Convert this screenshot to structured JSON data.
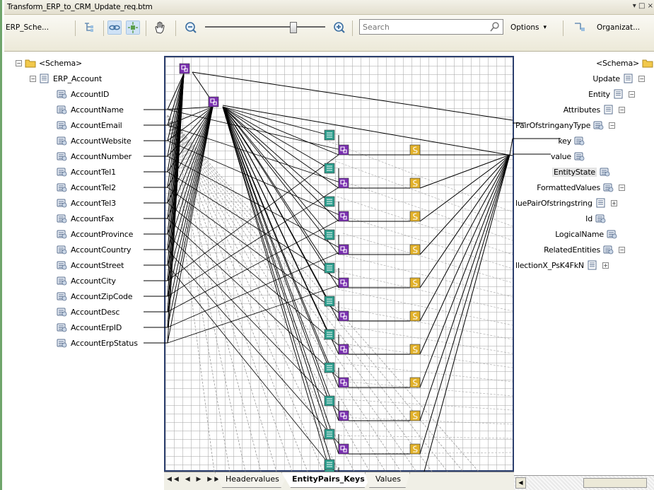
{
  "window": {
    "title": "Transform_ERP_to_CRM_Update_req.btm",
    "controls": "▾ □ ×"
  },
  "toolbar": {
    "source_schema_label": "ERP_Sche...",
    "search_placeholder": "Search",
    "options_label": "Options",
    "options_arrow": "▾",
    "organize_label": "Organizat..."
  },
  "source_tree": {
    "schema": "<Schema>",
    "root": "ERP_Account",
    "fields": [
      "AccountID",
      "AccountName",
      "AccountEmail",
      "AccountWebsite",
      "AccountNumber",
      "AccountTel1",
      "AccountTel2",
      "AccountTel3",
      "AccountFax",
      "AccountProvince",
      "AccountCountry",
      "AccountStreet",
      "AccountCity",
      "AccountZipCode",
      "AccountDesc",
      "AccountErpID",
      "AccountErpStatus"
    ]
  },
  "target_tree": {
    "schema": "<Schema>",
    "update": "Update",
    "entity": "Entity",
    "attributes": "Attributes",
    "kv_pair": "PairOfstringanyType",
    "key": "key",
    "value": "value",
    "entity_state": "EntityState",
    "formatted_values": "FormattedValues",
    "kv_pair2": "luePairOfstringstring",
    "id": "Id",
    "logical_name": "LogicalName",
    "related_entities": "RelatedEntities",
    "collection": "llectionX_PsK4FkN"
  },
  "tabs": {
    "nav": "◀◀ ◀ ▶ ▶▶",
    "items": [
      "Headervalues",
      "EntityPairs_Keys",
      "Values"
    ],
    "active": "EntityPairs_Keys"
  },
  "colors": {
    "grid_border": "#2c3f6e",
    "frame": "#6fa56b",
    "functoid_green": "#2e9e8e",
    "functoid_purple": "#7a2fb0",
    "functoid_gold": "#e2b12a"
  }
}
